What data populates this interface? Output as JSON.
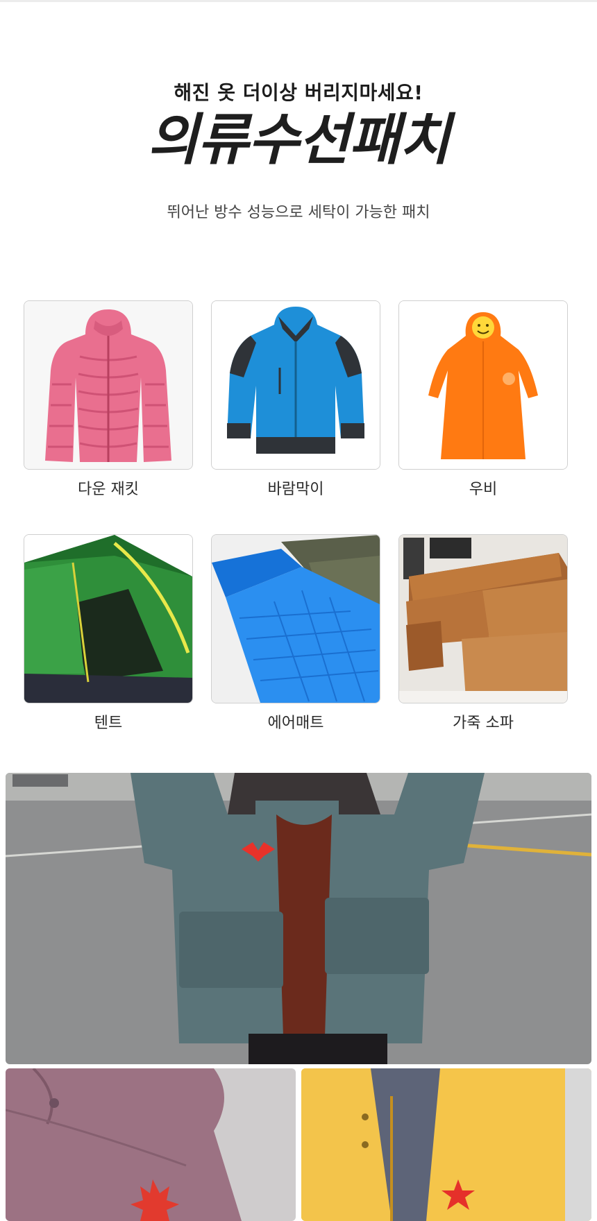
{
  "header": {
    "headline": "해진 옷 더이상 버리지마세요!",
    "title": "의류수선패치",
    "subtitle": "뛰어난 방수 성능으로 세탁이 가능한 패치"
  },
  "products": [
    {
      "label": "다운 재킷",
      "icon": "pink-down-jacket"
    },
    {
      "label": "바람막이",
      "icon": "blue-windbreaker"
    },
    {
      "label": "우비",
      "icon": "orange-raincoat"
    },
    {
      "label": "텐트",
      "icon": "green-tent"
    },
    {
      "label": "에어매트",
      "icon": "blue-air-mattress"
    },
    {
      "label": "가죽 소파",
      "icon": "brown-leather-sofa"
    }
  ],
  "photos": [
    {
      "name": "teal-puffer-bat-patch",
      "accent": "#e8322a"
    },
    {
      "name": "mauve-jacket-maple-patch",
      "accent": "#e23a2e"
    },
    {
      "name": "yellow-jacket-star-patch",
      "accent": "#e5302a"
    }
  ]
}
